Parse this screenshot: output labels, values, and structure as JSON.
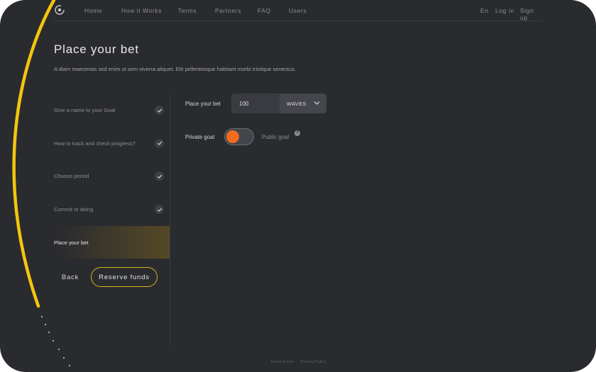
{
  "nav": {
    "links": [
      "Home",
      "How it Works",
      "Terms",
      "Partners",
      "FAQ",
      "Users"
    ],
    "language": "En",
    "login": "Log in",
    "signup": "Sign up"
  },
  "page": {
    "title": "Place your bet",
    "description": "A diam maecenas sed enim ut sem viverra aliquet. Elit pellentesque habitant morbi tristique senectus."
  },
  "steps": [
    {
      "label": "Give a name to your Goal",
      "done": true
    },
    {
      "label": "How to track and check progress?",
      "done": true
    },
    {
      "label": "Choose period",
      "done": true
    },
    {
      "label": "Commit to doing",
      "done": true
    },
    {
      "label": "Place your bet",
      "done": false,
      "active": true
    }
  ],
  "actions": {
    "back": "Back",
    "reserve": "Reserve funds"
  },
  "form": {
    "bet_label": "Place your bet",
    "bet_value": "100",
    "currency": "WAVES",
    "private_label": "Private goal",
    "public_label": "Public goal",
    "help_glyph": "?",
    "toggle_state": "private"
  },
  "footer": {
    "terms": "Terms of Use",
    "separator": "·",
    "privacy": "Privacy Policy"
  },
  "colors": {
    "background": "#2a2b2f",
    "accent_yellow": "#f2c522",
    "toggle_orange": "#f16c20"
  }
}
